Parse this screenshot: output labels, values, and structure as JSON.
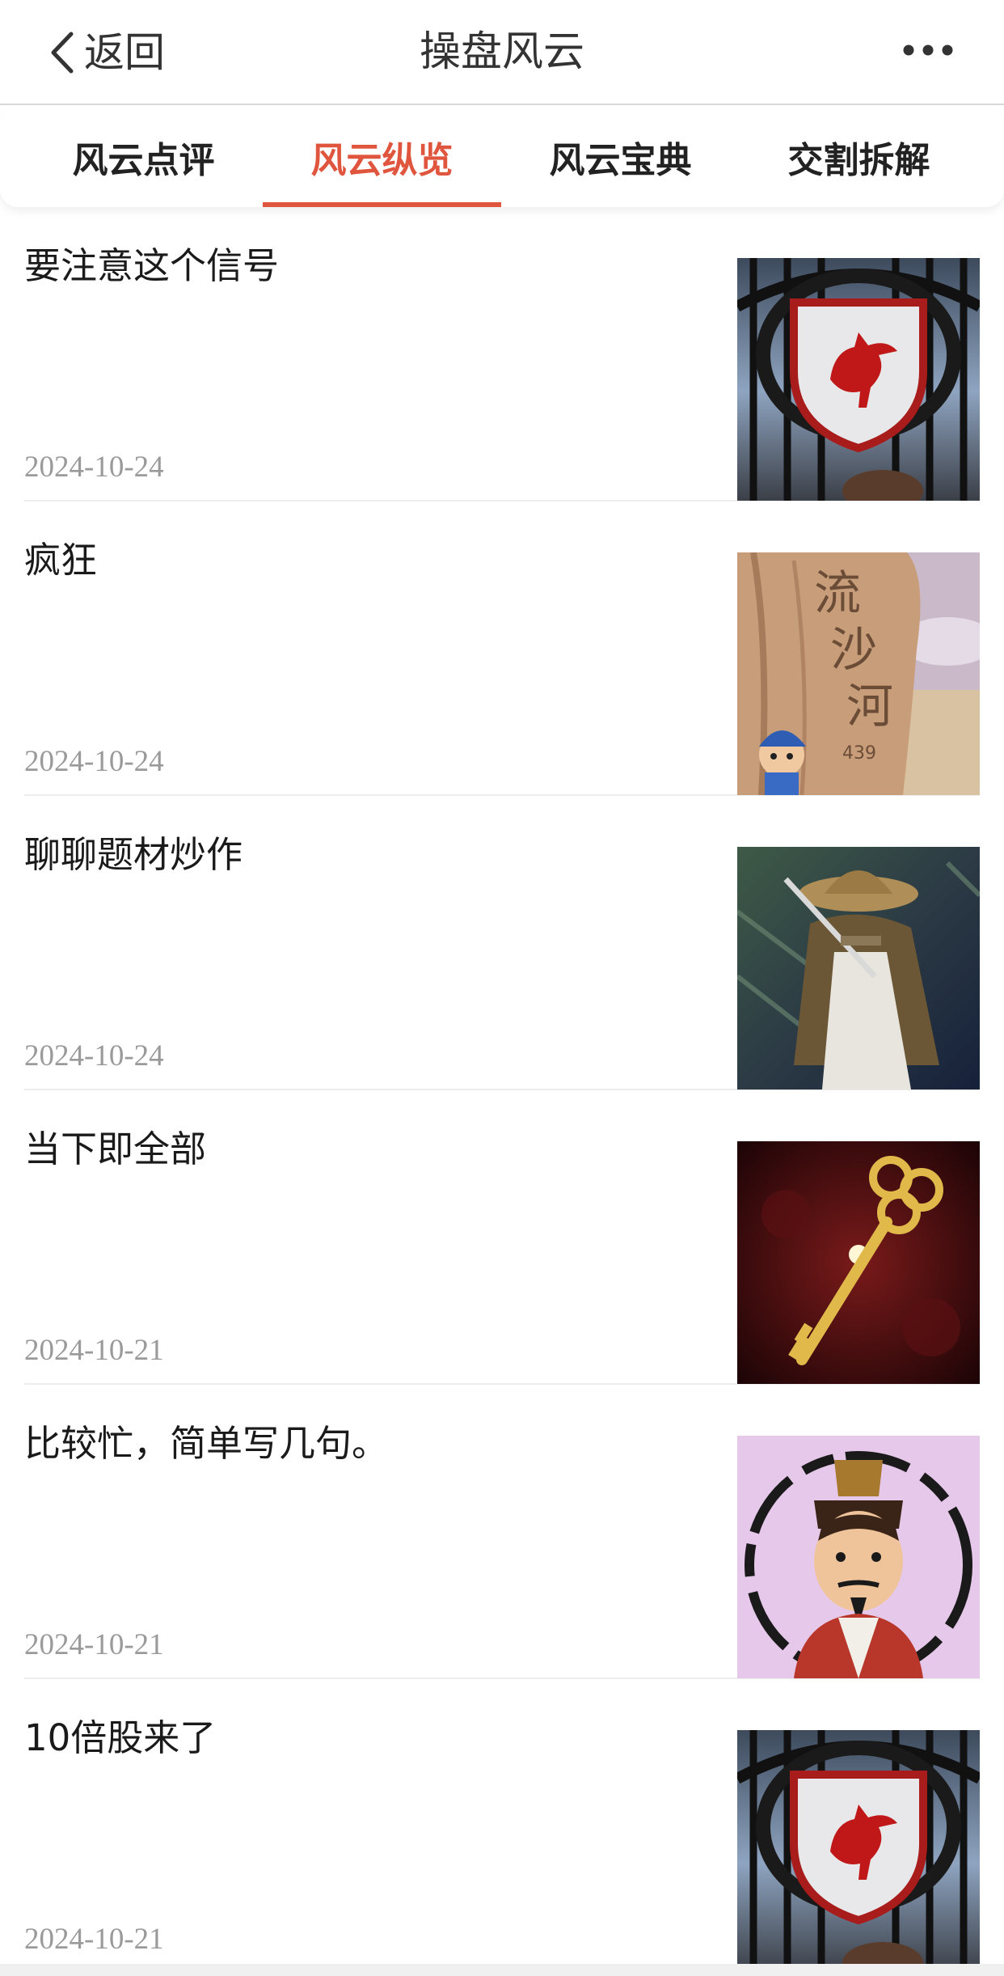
{
  "nav": {
    "back_label": "返回",
    "title": "操盘风云",
    "back_icon": "chevron-left-icon",
    "more_icon": "more-horizontal-icon"
  },
  "tabs": [
    {
      "label": "风云点评",
      "active": false
    },
    {
      "label": "风云纵览",
      "active": true
    },
    {
      "label": "风云宝典",
      "active": false
    },
    {
      "label": "交割拆解",
      "active": false
    }
  ],
  "articles": [
    {
      "title": "要注意这个信号",
      "date": "2024-10-24",
      "thumb": "liverbird-crest-image"
    },
    {
      "title": "疯狂",
      "date": "2024-10-24",
      "thumb": "engraved-stone-image"
    },
    {
      "title": "聊聊题材炒作",
      "date": "2024-10-24",
      "thumb": "straw-hat-swordsman-image"
    },
    {
      "title": "当下即全部",
      "date": "2024-10-21",
      "thumb": "golden-key-image"
    },
    {
      "title": "比较忙，简单写几句。",
      "date": "2024-10-21",
      "thumb": "official-portrait-image"
    },
    {
      "title": "10倍股来了",
      "date": "2024-10-21",
      "thumb": "liverbird-crest-image"
    }
  ],
  "colors": {
    "accent": "#e0553d",
    "text": "#1a1a1a",
    "date": "#9a9a9a",
    "divider": "#ededed"
  }
}
